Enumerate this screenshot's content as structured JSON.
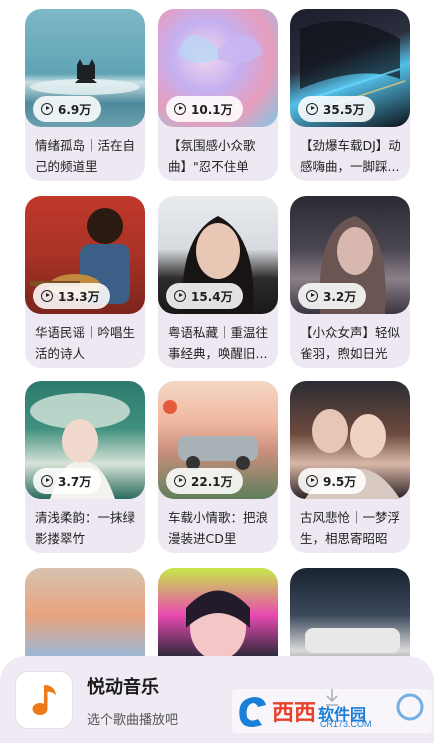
{
  "cards": [
    {
      "plays": "6.9万",
      "title": "情绪孤岛｜活在自己的频道里"
    },
    {
      "plays": "10.1万",
      "title": "【氛围感小众歌曲】\"忍不住单曲..."
    },
    {
      "plays": "35.5万",
      "title": "【劲爆车载DJ】动感嗨曲，一脚踩..."
    },
    {
      "plays": "13.3万",
      "title": "华语民谣｜吟唱生活的诗人"
    },
    {
      "plays": "15.4万",
      "title": "粤语私藏｜重温往事经典，唤醒旧..."
    },
    {
      "plays": "3.2万",
      "title": "【小众女声】轻似雀羽，煦如日光"
    },
    {
      "plays": "3.7万",
      "title": "清浅柔韵：一抹绿影搂翠竹"
    },
    {
      "plays": "22.1万",
      "title": "车载小情歌：把浪漫装进CD里"
    },
    {
      "plays": "9.5万",
      "title": "古风悲怆｜一梦浮生，相思寄昭昭"
    },
    {
      "plays": "",
      "title": ""
    },
    {
      "plays": "",
      "title": ""
    },
    {
      "plays": "",
      "title": ""
    }
  ],
  "player": {
    "app_name": "悦动音乐",
    "subtitle": "选个歌曲播放吧"
  },
  "watermark": {
    "brand": "西西",
    "text": "软件园",
    "domain": "CR173.COM"
  },
  "icons": {
    "play": "play-circle-icon",
    "music_note": "music-note-icon",
    "download": "download-icon"
  },
  "colors": {
    "card_bg": "#ede8f2",
    "player_bg": "#efeaf3",
    "note_orange": "#f07a1a",
    "watermark_blue": "#1a7fd6"
  }
}
